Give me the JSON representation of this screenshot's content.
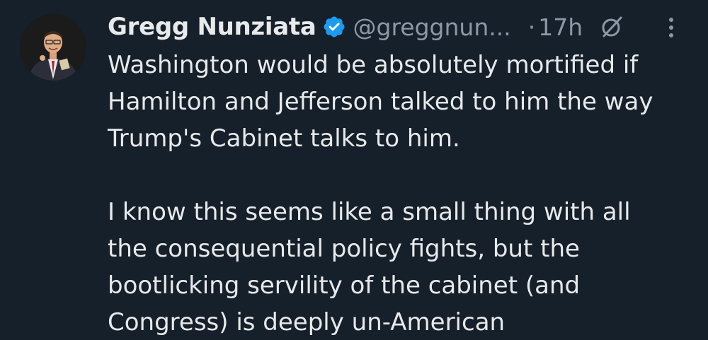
{
  "author": {
    "name": "Gregg Nunziata",
    "handle": "@greggnun...",
    "separator": "·",
    "time": "17h",
    "verified_color": "#1d9bf0",
    "icons": {
      "verified": "verified-badge-icon",
      "grok": "grok-icon",
      "more": "more-options-icon"
    }
  },
  "tweet": {
    "paragraphs": [
      {
        "lines": [
          "Washington would be absolutely mortified if",
          "Hamilton and Jefferson talked to him the way",
          "Trump's Cabinet talks to him."
        ]
      },
      {
        "lines": [
          "I know this seems like a small thing with all",
          "the consequential policy fights, but the",
          "bootlicking servility of the cabinet (and",
          "Congress) is deeply un-American"
        ]
      }
    ]
  },
  "colors": {
    "background": "#16202a",
    "text": "#e7e9ea",
    "muted": "#8b98a5",
    "accent": "#1d9bf0"
  }
}
